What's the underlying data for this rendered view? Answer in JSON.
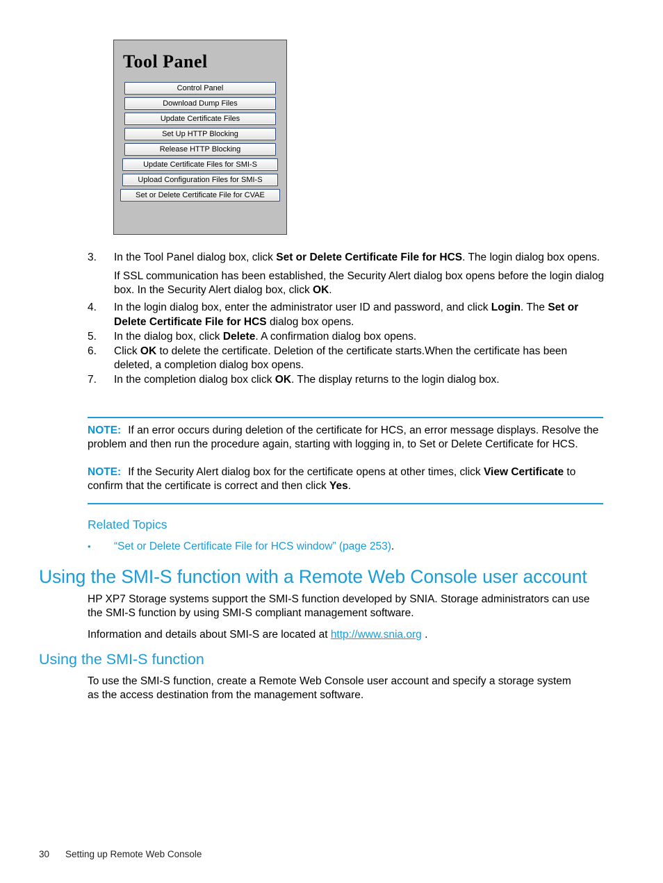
{
  "figure": {
    "name": "Tool Panel dialog box screenshot",
    "title": "Tool Panel",
    "buttons": [
      "Control Panel",
      "Download Dump Files",
      "Update Certificate Files",
      "Set Up HTTP Blocking",
      "Release HTTP Blocking",
      "Update Certificate Files for SMI-S",
      "Upload Configuration Files for SMI-S",
      "Set or Delete Certificate File for CVAE"
    ]
  },
  "steps": [
    {
      "num": "3.",
      "pre": "In the Tool Panel dialog box, click ",
      "bold": "Set or Delete Certificate File for HCS",
      "post": ". The login dialog box opens."
    },
    {
      "num": "4.",
      "pre": "In the login dialog box, enter the administrator user ID and password, and click ",
      "bold": "Login",
      "post": ". The ",
      "bold2": "Set or Delete Certificate File for HCS",
      "post2": " dialog box opens."
    },
    {
      "num": "5.",
      "pre": "In the dialog box, click ",
      "bold": "Delete",
      "post": ". A confirmation dialog box opens."
    },
    {
      "num": "6.",
      "pre": "Click ",
      "bold": "OK",
      "post": " to delete the certificate. Deletion of the certificate starts.When the certificate has been deleted, a completion dialog box opens."
    },
    {
      "num": "7.",
      "pre": "In the completion dialog box click ",
      "bold": "OK",
      "post": ". The display returns to the login dialog box."
    }
  ],
  "sub_paragraph": {
    "pre": "If SSL communication has been established, the Security Alert dialog box opens before the login dialog box. In the Security Alert dialog box, click ",
    "bold": "OK",
    "post": "."
  },
  "notes": {
    "label": "NOTE:",
    "items": [
      {
        "text": "If an error occurs during deletion of the certificate for HCS, an error message displays. Resolve the problem and then run the procedure again, starting with logging in, to Set or Delete Certificate for HCS."
      },
      {
        "pre": "If the Security Alert dialog box for the certificate opens at other times, click ",
        "bold": "View Certificate",
        "mid": " to confirm that the certificate is correct and then click ",
        "bold2": "Yes",
        "post": "."
      }
    ]
  },
  "related": {
    "title": "Related Topics",
    "bullet": "•",
    "link_text": "“Set or Delete Certificate File for HCS window” (page 253)",
    "trailing": "."
  },
  "section1": {
    "heading": "Using the SMI-S function with a Remote Web Console user account",
    "paragraph1": "HP XP7 Storage systems support the SMI-S function developed by SNIA. Storage administrators can use the SMI-S function by using SMI-S compliant management software.",
    "paragraph2_pre": "Information and details about SMI-S are located at ",
    "paragraph2_link": "http://www.snia.org",
    "paragraph2_post": " ."
  },
  "section2": {
    "heading": "Using the SMI-S function",
    "paragraph1": "To use the SMI-S function, create a Remote Web Console user account and specify a storage system as the access destination from the management software."
  },
  "footer": {
    "page_number": "30",
    "chapter_title": "Setting up Remote Web Console"
  },
  "colors": {
    "accent_blue": "#1a9cd8",
    "note_label_blue": "#0c93d4",
    "panel_gray": "#c0c0c0",
    "button_border": "#2b4a7a"
  }
}
